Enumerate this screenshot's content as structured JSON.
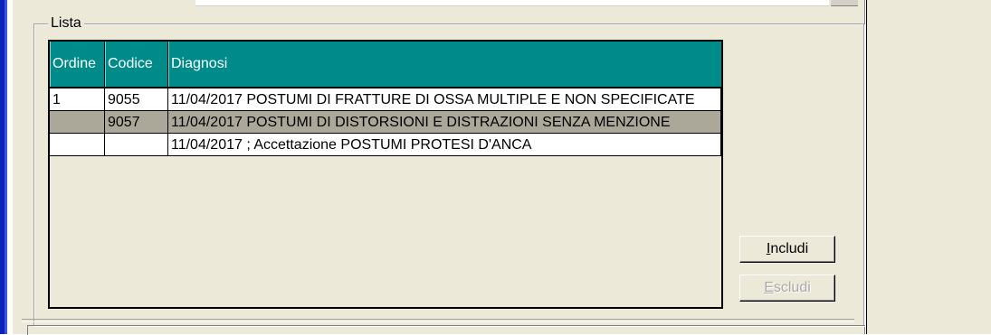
{
  "group": {
    "label": "Lista"
  },
  "grid": {
    "columns": [
      "Ordine",
      "Codice",
      "Diagnosi"
    ],
    "rows": [
      {
        "ordine": "1",
        "codice": "9055",
        "diagnosi": "11/04/2017 POSTUMI DI FRATTURE DI OSSA MULTIPLE E NON SPECIFICATE"
      },
      {
        "ordine": "",
        "codice": "9057",
        "diagnosi": "11/04/2017 POSTUMI DI DISTORSIONI E DISTRAZIONI SENZA MENZIONE"
      },
      {
        "ordine": "",
        "codice": "",
        "diagnosi": "11/04/2017  ; Accettazione POSTUMI PROTESI D'ANCA"
      }
    ]
  },
  "buttons": {
    "includi": {
      "accel": "I",
      "rest": "ncludi"
    },
    "escludi": {
      "accel": "E",
      "rest": "scludi"
    }
  },
  "colors": {
    "header_bg": "#008b8b",
    "selected_row": "#aca899",
    "panel_bg": "#ece9d8",
    "window_frame": "#0a24b8"
  }
}
